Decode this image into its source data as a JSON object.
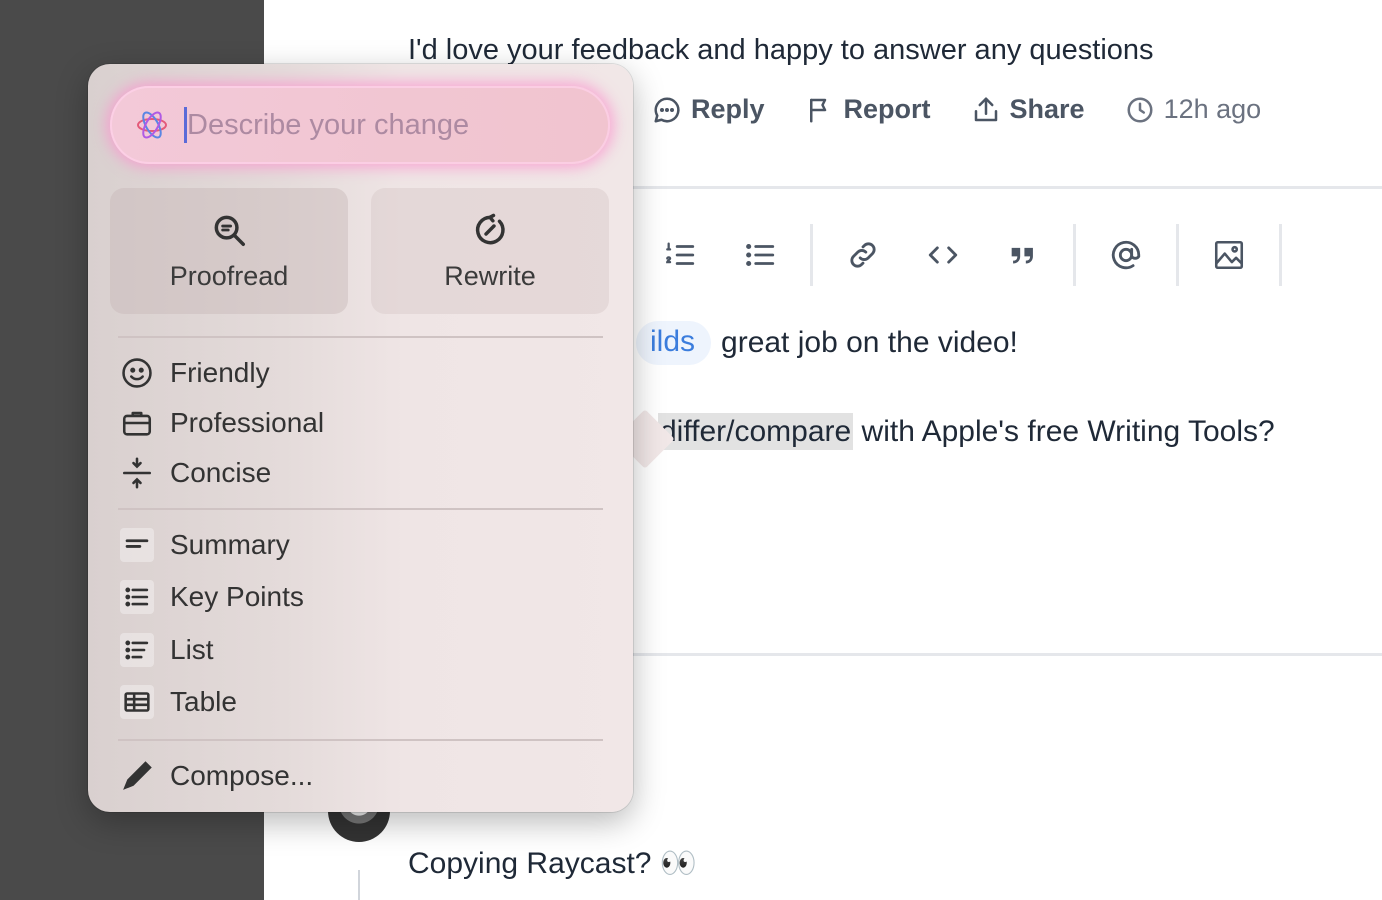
{
  "comment": {
    "text": "I'd love your feedback and happy to answer any questions"
  },
  "actions": {
    "reply": "Reply",
    "report": "Report",
    "share": "Share",
    "time": "12h ago"
  },
  "editor": {
    "mention": "ilds",
    "line1_text": "great job on the video!",
    "line2_selected": "differ/compare",
    "line2_rest": " with Apple's free Writing Tools?"
  },
  "reply": {
    "text": "Copying Raycast? 👀"
  },
  "writing_tools": {
    "prompt_placeholder": "Describe your change",
    "proofread": "Proofread",
    "rewrite": "Rewrite",
    "tones": [
      {
        "label": "Friendly",
        "icon": "smile-icon"
      },
      {
        "label": "Professional",
        "icon": "briefcase-icon"
      },
      {
        "label": "Concise",
        "icon": "concise-icon"
      }
    ],
    "formats": [
      {
        "label": "Summary",
        "icon": "summary-icon"
      },
      {
        "label": "Key Points",
        "icon": "key-points-icon"
      },
      {
        "label": "List",
        "icon": "list-icon"
      },
      {
        "label": "Table",
        "icon": "table-icon"
      }
    ],
    "compose": "Compose..."
  }
}
